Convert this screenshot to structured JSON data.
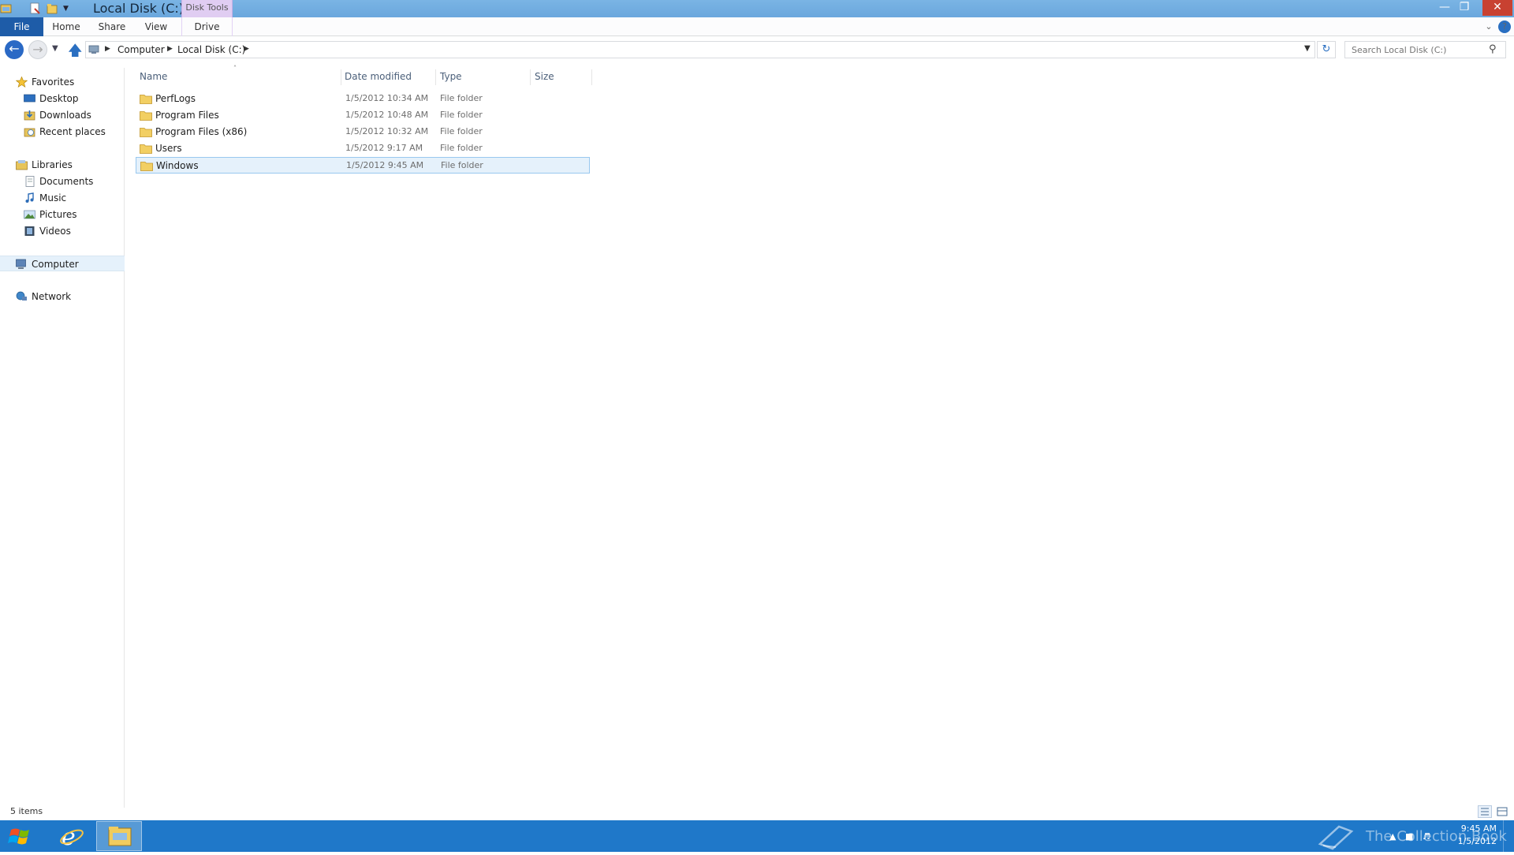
{
  "window": {
    "title": "Local Disk (C:)",
    "contextual_tab_group": "Disk Tools"
  },
  "ribbon": {
    "tabs": [
      "File",
      "Home",
      "Share",
      "View",
      "Drive"
    ]
  },
  "address": {
    "crumbs": [
      "Computer",
      "Local Disk (C:)"
    ],
    "search_placeholder": "Search Local Disk (C:)"
  },
  "navpane": {
    "favorites": {
      "label": "Favorites",
      "items": [
        "Desktop",
        "Downloads",
        "Recent places"
      ]
    },
    "libraries": {
      "label": "Libraries",
      "items": [
        "Documents",
        "Music",
        "Pictures",
        "Videos"
      ]
    },
    "computer": "Computer",
    "network": "Network"
  },
  "filelist": {
    "columns": [
      "Name",
      "Date modified",
      "Type",
      "Size"
    ],
    "rows": [
      {
        "name": "PerfLogs",
        "date": "1/5/2012 10:34 AM",
        "type": "File folder"
      },
      {
        "name": "Program Files",
        "date": "1/5/2012 10:48 AM",
        "type": "File folder"
      },
      {
        "name": "Program Files (x86)",
        "date": "1/5/2012 10:32 AM",
        "type": "File folder"
      },
      {
        "name": "Users",
        "date": "1/5/2012 9:17 AM",
        "type": "File folder"
      },
      {
        "name": "Windows",
        "date": "1/5/2012 9:45 AM",
        "type": "File folder"
      }
    ],
    "selected_row": "Windows"
  },
  "statusbar": {
    "item_count": "5 items"
  },
  "taskbar": {
    "watermark": "The Collection Book",
    "time": "9:45 AM",
    "date": "1/5/2012"
  },
  "colors": {
    "titlebar": "#6aa7dd",
    "file_tab": "#1e5ca8",
    "disk_tools": "#e0cdf2",
    "taskbar": "#1f78c9",
    "selection": "#e5f1fb",
    "close_button": "#c84131"
  },
  "icons": [
    "explorer-icon",
    "properties-icon",
    "new-folder-icon",
    "qat-dropdown-icon",
    "back-arrow-icon",
    "forward-arrow-icon",
    "up-arrow-icon",
    "refresh-icon",
    "search-icon",
    "star-icon",
    "desktop-icon",
    "downloads-icon",
    "recent-places-icon",
    "libraries-icon",
    "documents-icon",
    "music-icon",
    "pictures-icon",
    "videos-icon",
    "computer-icon",
    "network-icon",
    "folder-icon",
    "windows-logo-icon",
    "internet-explorer-icon",
    "help-icon"
  ]
}
